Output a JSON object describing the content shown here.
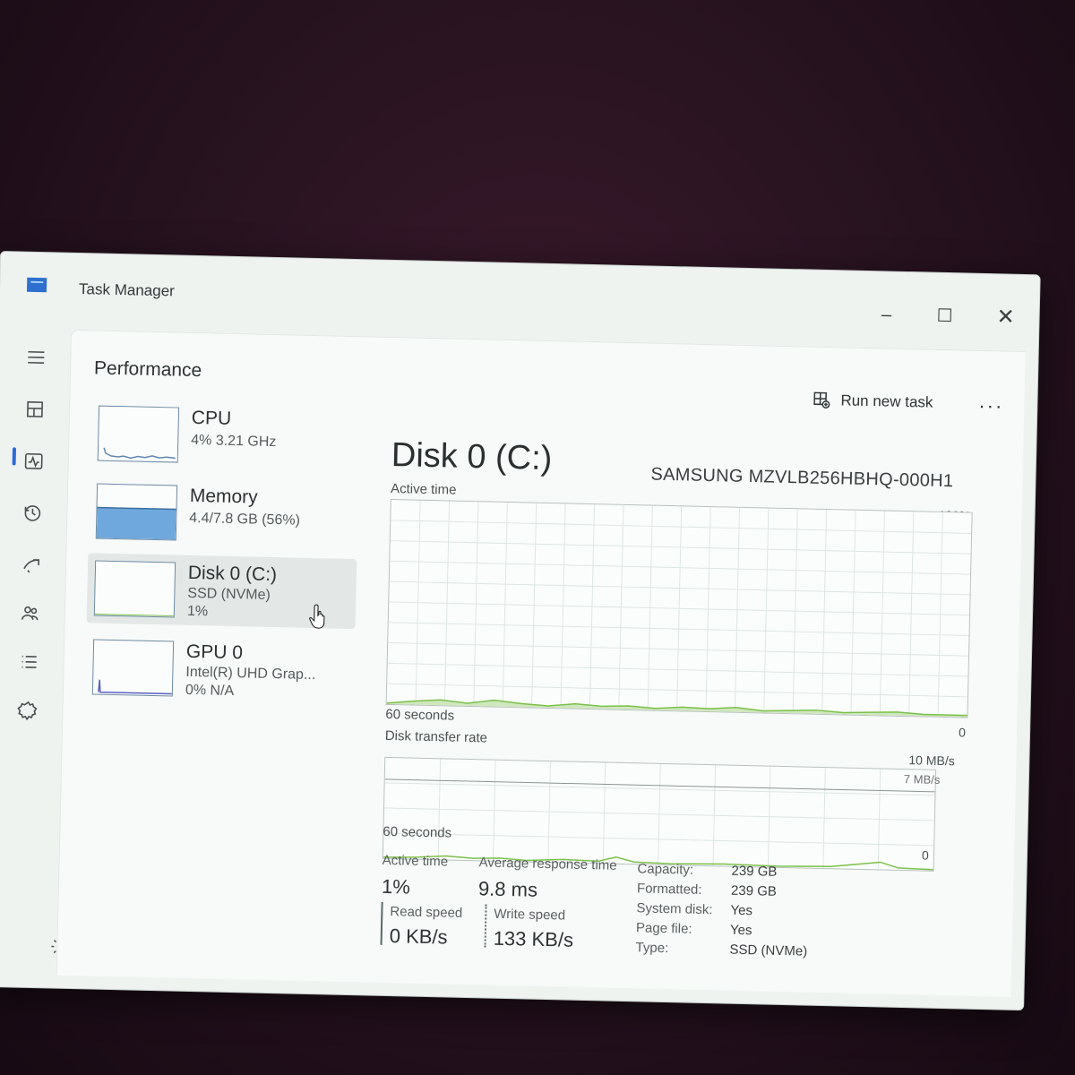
{
  "window": {
    "title": "Task Manager",
    "controls": [
      "–",
      "☐",
      "✕"
    ]
  },
  "header": {
    "page_title": "Performance",
    "run_new_task": "Run new task",
    "more": "···"
  },
  "sidebar": {
    "devices": [
      {
        "name": "CPU",
        "line1": "4% 3.21 GHz",
        "line2": ""
      },
      {
        "name": "Memory",
        "line1": "4.4/7.8 GB (56%)",
        "line2": ""
      },
      {
        "name": "Disk 0 (C:)",
        "line1": "SSD (NVMe)",
        "line2": "1%"
      },
      {
        "name": "GPU 0",
        "line1": "Intel(R) UHD Grap...",
        "line2": "0% N/A"
      }
    ],
    "selected": "Disk 0 (C:)"
  },
  "nav_icons": [
    "menu-icon",
    "processes-icon",
    "performance-icon",
    "app-history-icon",
    "startup-apps-icon",
    "users-icon",
    "details-icon",
    "services-icon",
    "settings-icon"
  ],
  "detail": {
    "title": "Disk 0 (C:)",
    "model": "SAMSUNG MZVLB256HBHQ-000H1",
    "active_time_graph": {
      "label": "Active time",
      "max": "100%",
      "min": "0",
      "time": "60 seconds"
    },
    "transfer_graph": {
      "label": "Disk transfer rate",
      "max": "10 MB/s",
      "mark": "7 MB/s",
      "min": "0",
      "time": "60 seconds"
    },
    "stats": {
      "active_time_label": "Active time",
      "active_time": "1%",
      "avg_response_label": "Average response time",
      "avg_response": "9.8 ms",
      "read_label": "Read speed",
      "read": "0 KB/s",
      "write_label": "Write speed",
      "write": "133 KB/s"
    },
    "properties": [
      {
        "label": "Capacity:",
        "value": "239 GB"
      },
      {
        "label": "Formatted:",
        "value": "239 GB"
      },
      {
        "label": "System disk:",
        "value": "Yes"
      },
      {
        "label": "Page file:",
        "value": "Yes"
      },
      {
        "label": "Type:",
        "value": "SSD (NVMe)"
      }
    ]
  },
  "colors": {
    "accent": "#2a6cd6",
    "graph_line": "#7cc04a",
    "memory_fill": "#6fa8dc"
  }
}
